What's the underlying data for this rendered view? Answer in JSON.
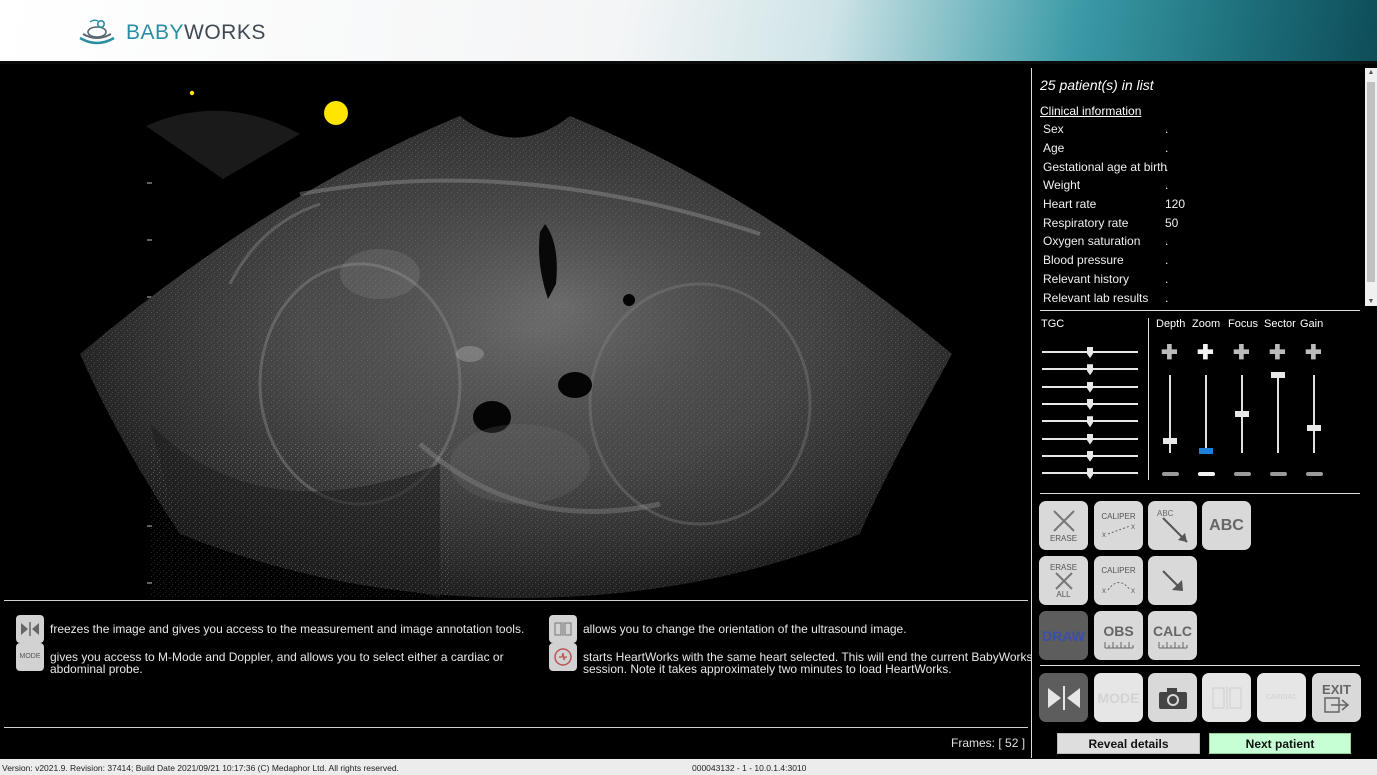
{
  "header": {
    "brand_part1": "BABY",
    "brand_part2": "WORKS"
  },
  "viewport": {
    "frames_label": "Frames:",
    "frames_value": "[ 52 ]"
  },
  "help": [
    {
      "icon": "freeze-icon",
      "icon_text": "",
      "text": "freezes the image and gives you access to the measurement and image annotation tools."
    },
    {
      "icon": "mode-icon",
      "icon_text": "MODE",
      "text": "gives you access to M-Mode and Doppler, and allows you to select either a cardiac or abdominal probe."
    },
    {
      "icon": "orientation-icon",
      "icon_text": "",
      "text": "allows you to change the orientation of the ultrasound image."
    },
    {
      "icon": "heartworks-icon",
      "icon_text": "",
      "text": "starts HeartWorks with the same heart selected. This will end the current BabyWorks session. Note it takes approximately two minutes to load HeartWorks."
    }
  ],
  "patients": {
    "count_text": "25 patient(s) in list",
    "clinical_title": "Clinical information",
    "rows": [
      {
        "label": "Sex",
        "value": "."
      },
      {
        "label": "Age",
        "value": "."
      },
      {
        "label": "Gestational age at birth",
        "value": "."
      },
      {
        "label": "Weight",
        "value": "."
      },
      {
        "label": "Heart rate",
        "value": "120"
      },
      {
        "label": "Respiratory rate",
        "value": "50"
      },
      {
        "label": "Oxygen saturation",
        "value": "."
      },
      {
        "label": "Blood pressure",
        "value": "."
      },
      {
        "label": "Relevant history",
        "value": "."
      },
      {
        "label": "Relevant lab results",
        "value": "."
      }
    ]
  },
  "controls": {
    "tgc_label": "TGC",
    "tgc_levels": [
      0.5,
      0.5,
      0.5,
      0.5,
      0.5,
      0.5,
      0.5,
      0.5
    ],
    "sliders": [
      {
        "label": "Depth",
        "level": 0.15,
        "active": false
      },
      {
        "label": "Zoom",
        "level": 0.03,
        "active": true
      },
      {
        "label": "Focus",
        "level": 0.5,
        "active": false
      },
      {
        "label": "Sector",
        "level": 1.0,
        "active": false
      },
      {
        "label": "Gain",
        "level": 0.32,
        "active": false
      }
    ],
    "accent_color": "#1e7fd6"
  },
  "tools": {
    "erase": "ERASE",
    "caliper": "CALIPER",
    "abc_arrow": "ABC",
    "abc_text": "ABC",
    "erase_all_1": "ERASE",
    "erase_all_2": "ALL",
    "caliper2": "CALIPER",
    "draw": "DRAW",
    "obs": "OBS",
    "calc": "CALC",
    "mode": "MODE",
    "cardiac": "CARDIAC",
    "exit": "EXIT"
  },
  "actions": {
    "reveal": "Reveal details",
    "next": "Next patient"
  },
  "status": {
    "left": "Version: v2021.9. Revision: 37414; Build Date 2021/09/21 10:17:36 (C) Medaphor Ltd. All rights reserved.",
    "center": "000043132  - 1 -  10.0.1.4:3010"
  }
}
